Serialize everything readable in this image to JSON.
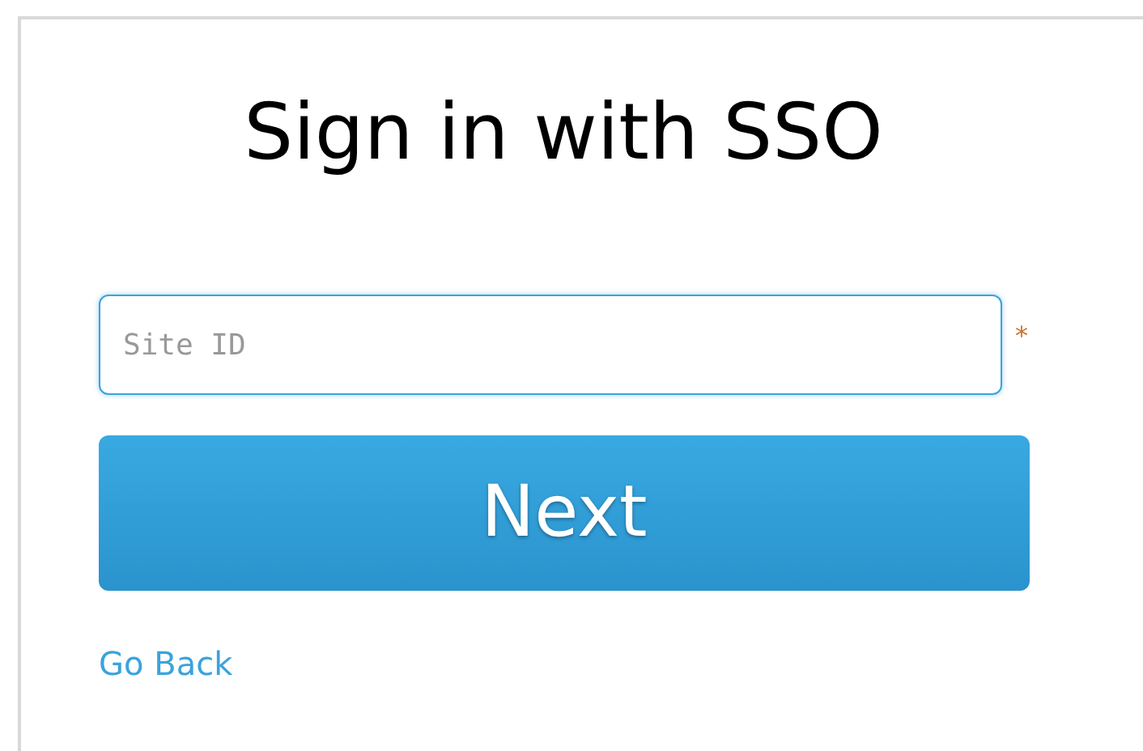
{
  "title": "Sign in with SSO",
  "site_id_field": {
    "placeholder": "Site ID",
    "required_mark": "*",
    "focused": true
  },
  "next_button": {
    "label": "Next"
  },
  "go_back_link": {
    "label": "Go Back"
  }
}
